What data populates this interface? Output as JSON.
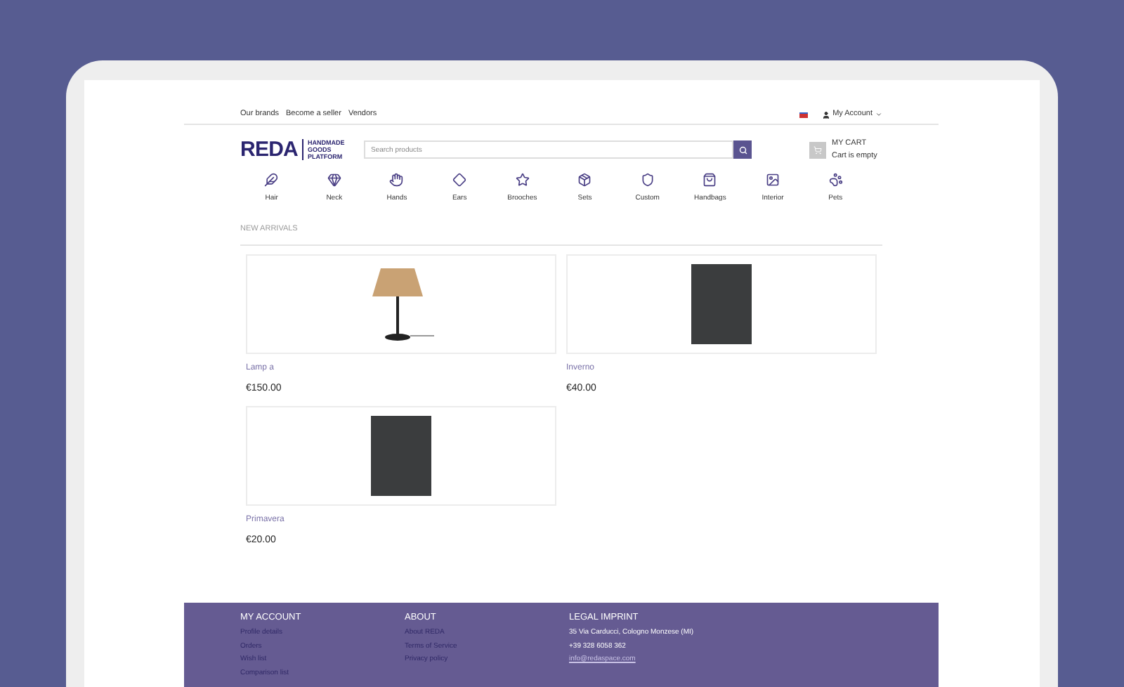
{
  "top_links": [
    "Our brands",
    "Become a seller",
    "Vendors"
  ],
  "account": {
    "label": "My Account"
  },
  "logo": {
    "text": "REDA",
    "tagline": [
      "HANDMADE",
      "GOODS",
      "PLATFORM"
    ]
  },
  "search": {
    "placeholder": "Search products"
  },
  "cart": {
    "title": "MY CART",
    "status": "Cart is empty"
  },
  "categories": [
    "Hair",
    "Neck",
    "Hands",
    "Ears",
    "Brooches",
    "Sets",
    "Custom",
    "Handbags",
    "Interior",
    "Pets"
  ],
  "section_title": "NEW ARRIVALS",
  "products": [
    {
      "name": "Lamp a",
      "price": "€150.00",
      "kind": "lamp"
    },
    {
      "name": "Inverno",
      "price": "€40.00",
      "kind": "photo"
    },
    {
      "name": "Primavera",
      "price": "€20.00",
      "kind": "photo"
    }
  ],
  "footer": [
    {
      "title": "MY ACCOUNT",
      "kind": "links",
      "items": [
        "Profile details",
        "Orders",
        "Wish list",
        "Comparison list"
      ]
    },
    {
      "title": "ABOUT",
      "kind": "links",
      "items": [
        "About REDA",
        "Terms of Service",
        "Privacy policy"
      ]
    },
    {
      "title": "LEGAL IMPRINT",
      "kind": "contact",
      "items": [
        "35 Via Carducci, Cologno Monzese (MI)",
        "+39 328 6058 362",
        "info@redaspace.com"
      ]
    }
  ]
}
